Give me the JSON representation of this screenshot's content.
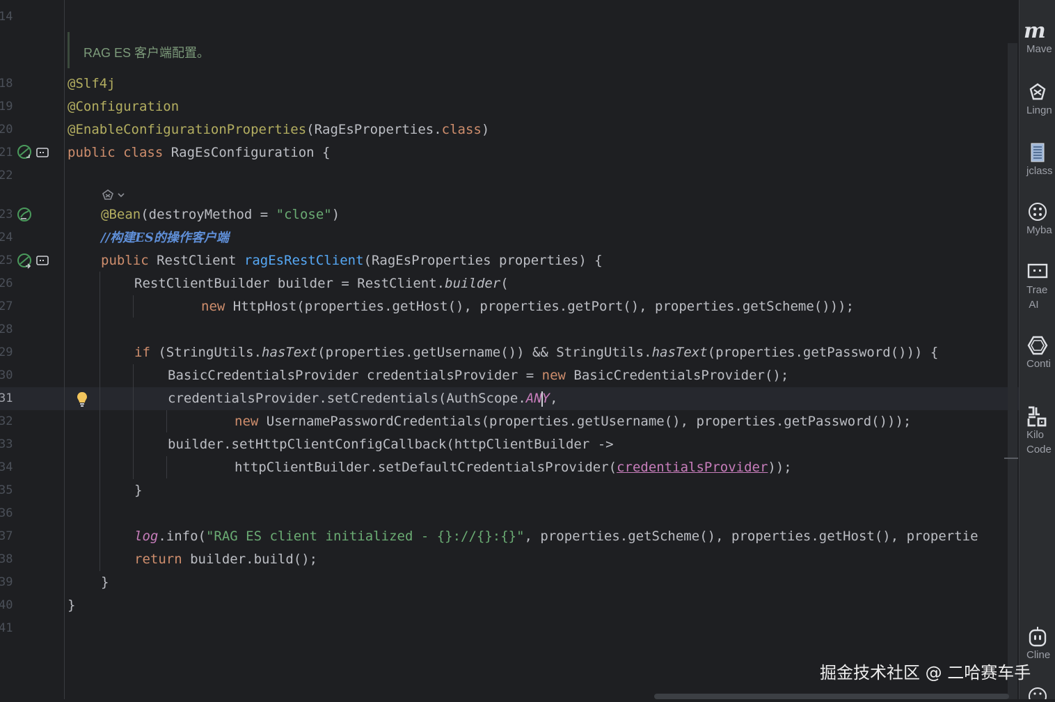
{
  "editor": {
    "line_numbers": [
      "14",
      "18",
      "19",
      "20",
      "21",
      "22",
      "23",
      "24",
      "25",
      "26",
      "27",
      "28",
      "29",
      "30",
      "31",
      "32",
      "33",
      "34",
      "35",
      "36",
      "37",
      "38",
      "39",
      "40",
      "41"
    ],
    "doc_comment": "RAG ES 客户端配置。",
    "lines": {
      "l18": "@Slf4j",
      "l19": "@Configuration",
      "l20a": "@EnableConfigurationProperties",
      "l20b": "(RagEsProperties.",
      "l20c": "class",
      "l20d": ")",
      "l21a": "public class",
      "l21b": " RagEsConfiguration {",
      "l23a": "@Bean",
      "l23b": "(destroyMethod = ",
      "l23c": "\"close\"",
      "l23d": ")",
      "l24": "//构建ES的操作客户端",
      "l25a": "public",
      "l25b": " RestClient ",
      "l25c": "ragEsRestClient",
      "l25d": "(RagEsProperties properties) {",
      "l26a": "RestClientBuilder builder = RestClient.",
      "l26b": "builder",
      "l26c": "(",
      "l27a": "new",
      "l27b": " HttpHost(properties.getHost(), properties.getPort(), properties.getScheme()));",
      "l29a": "if",
      "l29b": " (StringUtils.",
      "l29c": "hasText",
      "l29d": "(properties.getUsername()) && StringUtils.",
      "l29e": "hasText",
      "l29f": "(properties.getPassword())) {",
      "l30a": "BasicCredentialsProvider credentialsProvider = ",
      "l30b": "new",
      "l30c": " BasicCredentialsProvider();",
      "l31a": "credentialsProvider.setCredentials(AuthScope.",
      "l31b": "AN",
      "l31c": "Y",
      "l31d": ",",
      "l32a": "new",
      "l32b": " UsernamePasswordCredentials(properties.getUsername(), properties.getPassword()));",
      "l33": "builder.setHttpClientConfigCallback(httpClientBuilder ->",
      "l34a": "httpClientBuilder.setDefaultCredentialsProvider(",
      "l34b": "credentialsProvider",
      "l34c": "));",
      "l35": "}",
      "l37a": "log",
      "l37b": ".info(",
      "l37c": "\"RAG ES client initialized - {}://{}:{}\"",
      "l37d": ", properties.getScheme(), properties.getHost(), propertie",
      "l38a": "return",
      "l38b": " builder.build();",
      "l39": "}",
      "l40": "}"
    }
  },
  "right_toolbar": {
    "items": [
      {
        "icon": "maven-icon",
        "label": "Mave"
      },
      {
        "icon": "lingma-icon",
        "label": "Lingn"
      },
      {
        "icon": "jclasslib-icon",
        "label": "jclass"
      },
      {
        "icon": "mybatis-icon",
        "label": "Myba"
      },
      {
        "icon": "trae-ai-icon",
        "label": "Trae\n AI"
      },
      {
        "icon": "continue-icon",
        "label": "Conti"
      },
      {
        "icon": "kilo-code-icon",
        "label": "Kilo\nCode"
      },
      {
        "icon": "cline-icon",
        "label": "Cline"
      }
    ]
  },
  "watermark": "掘金技术社区 @ 二哈赛车手",
  "colors": {
    "background": "#1e1f22",
    "keyword": "#cf8e6d",
    "annotation": "#b3ae60",
    "string": "#6aab73",
    "function": "#56a8f5",
    "static_field": "#c77dbb",
    "gutter_green": "#4a9a5c"
  }
}
